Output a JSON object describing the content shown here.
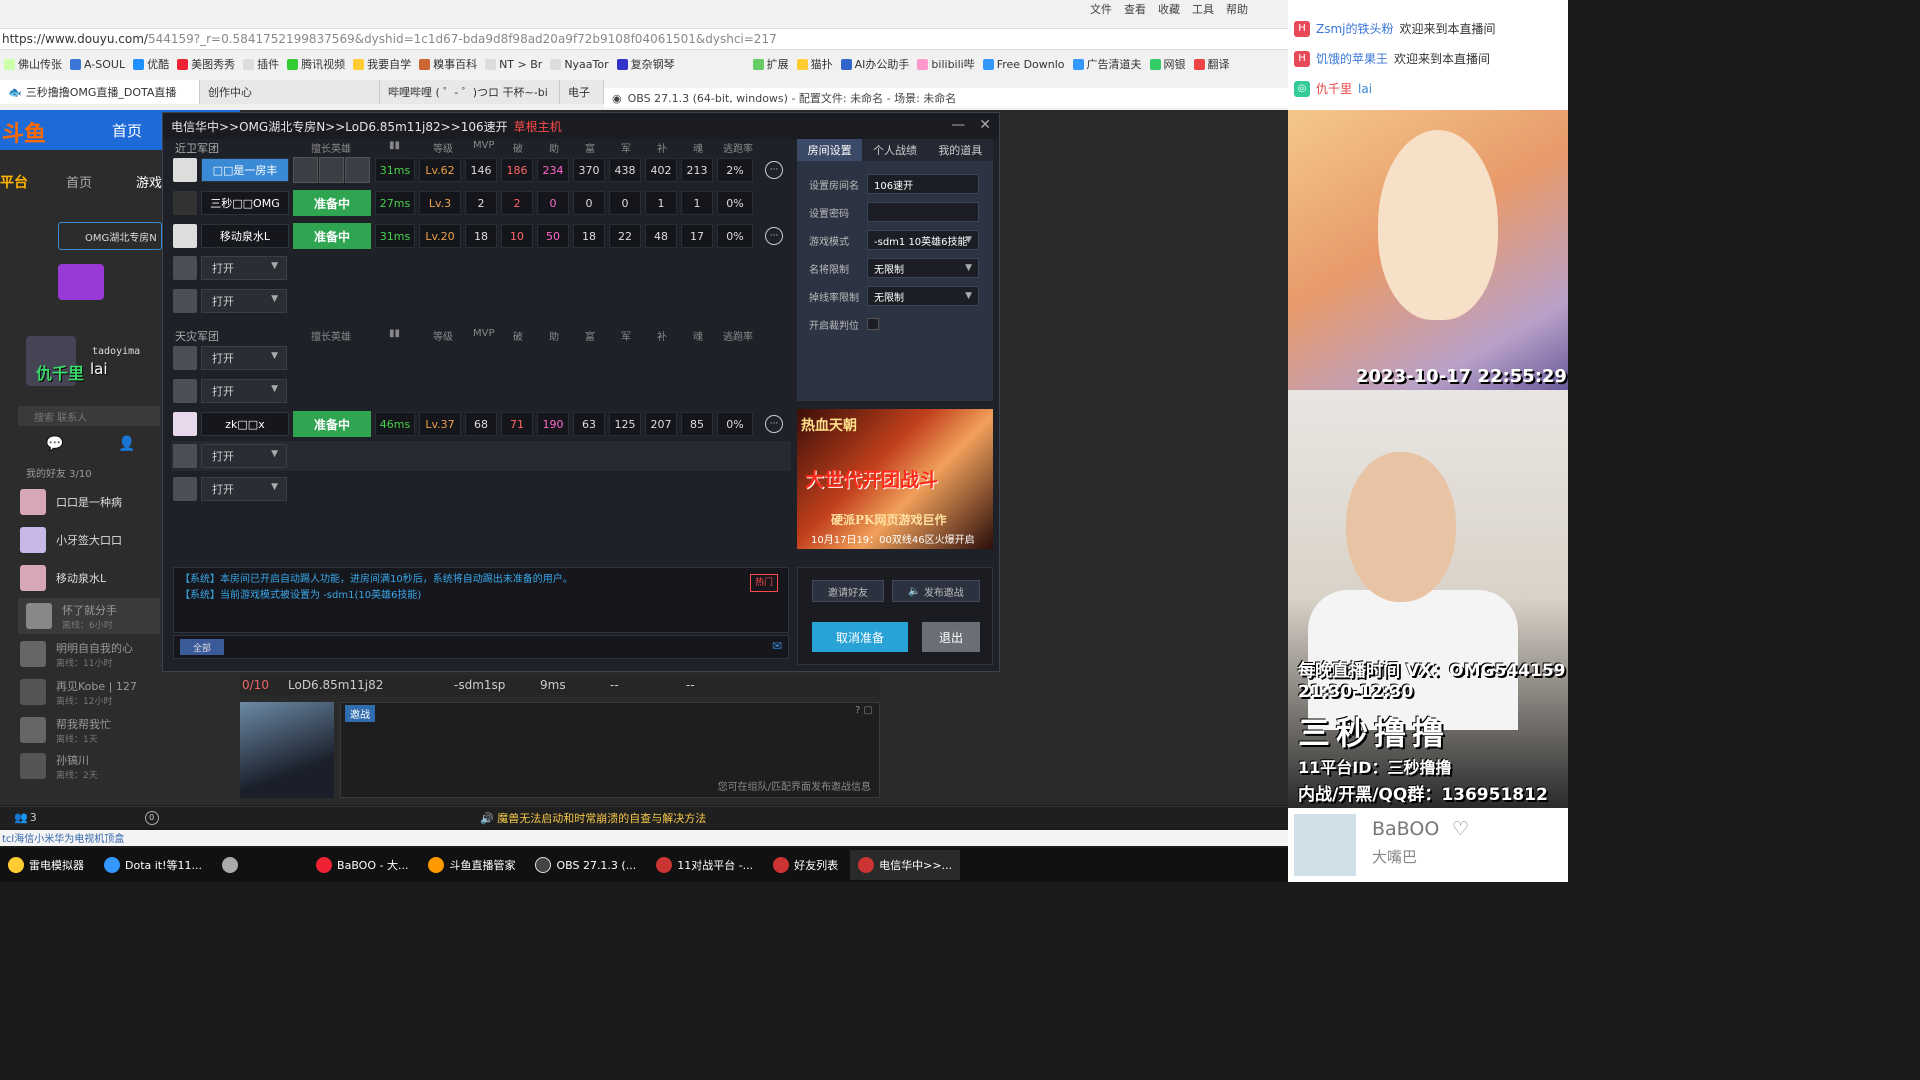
{
  "browser": {
    "menu": [
      "文件",
      "查看",
      "收藏",
      "工具",
      "帮助"
    ],
    "url_main": "https://www.douyu.com/",
    "url_rest": "544159?_r=0.5841752199837569&dyshid=1c1d67-bda9d8f98ad20a9f72b9108f04061501&dyshci=217",
    "bookmarks": [
      "佛山传张",
      "A-SOUL",
      "优酷",
      "美图秀秀",
      "插件",
      "腾讯视频",
      "我要自学",
      "糗事百科",
      "NT > Br",
      "NyaaTor",
      "复杂钢琴",
      "扩展",
      "猫扑",
      "AI办公助手",
      "bilibili哔",
      "Free Downlo",
      "广告清道夫",
      "网银",
      "翻译"
    ],
    "tabs": [
      {
        "label": "三秒撸撸OMG直播_DOTA直播",
        "active": true
      },
      {
        "label": "创作中心",
        "active": false
      },
      {
        "label": "哔哩哔哩 ( ゜- ゜)つロ 干杯~-bi",
        "active": false
      },
      {
        "label": "电子",
        "active": false
      }
    ],
    "obs_title": "OBS 27.1.3 (64-bit, windows) - 配置文件: 未命名 - 场景: 未命名"
  },
  "douyu": {
    "logo": "斗鱼",
    "home": "首页",
    "nav": [
      "平台",
      "首页",
      "游戏"
    ],
    "streamer_nick": "tadoyima",
    "overlay_name": "仇千里",
    "overlay_msg": "lai",
    "room_tag": "OMG湖北专房N",
    "search_placeholder": "搜索 联系人",
    "friends_header": "我的好友 3/10",
    "friends": [
      {
        "name": "口口是一种病",
        "status": ""
      },
      {
        "name": "小牙签大口口",
        "status": ""
      },
      {
        "name": "移动泉水L",
        "status": ""
      },
      {
        "name": "怀了就分手",
        "status": "离线：6小时"
      },
      {
        "name": "明明自自我的心",
        "status": "离线：11小时"
      },
      {
        "name": "再见Kobe | 127",
        "status": "离线：12小时"
      },
      {
        "name": "帮我帮我忙",
        "status": "离线：1天"
      },
      {
        "name": "孙镐川",
        "status": "离线：2天"
      }
    ]
  },
  "client": {
    "title": "电信华中>>OMG湖北专房N>>LoD6.85m11j82>>106速开",
    "host_tag": "草根主机",
    "sentinel_label": "近卫军团",
    "scourge_label": "天灾军团",
    "columns": [
      "擅长英雄",
      "等级",
      "MVP",
      "破",
      "助",
      "富",
      "军",
      "补",
      "魂",
      "逃跑率"
    ],
    "ready_label": "准备中",
    "open_label": "打开",
    "sentinel": [
      {
        "name": "□□是一房丰",
        "host": true,
        "heroes": true,
        "ping": "31ms",
        "lv": "Lv.62",
        "v1": "146",
        "v2": "186",
        "v3": "234",
        "v4": "370",
        "v5": "438",
        "v6": "402",
        "v7": "213",
        "v8": "2%"
      },
      {
        "name": "三秒□□OMG",
        "ready": true,
        "ping": "27ms",
        "lv": "Lv.3",
        "v1": "2",
        "v2": "2",
        "v3": "0",
        "v4": "0",
        "v5": "0",
        "v6": "1",
        "v7": "1",
        "v8": "0%"
      },
      {
        "name": "移动泉水L",
        "ready": true,
        "ping": "31ms",
        "lv": "Lv.20",
        "v1": "18",
        "v2": "10",
        "v3": "50",
        "v4": "18",
        "v5": "22",
        "v6": "48",
        "v7": "17",
        "v8": "0%"
      }
    ],
    "scourge_player": {
      "name": "zk□□x",
      "ping": "46ms",
      "lv": "Lv.37",
      "v1": "68",
      "v2": "71",
      "v3": "190",
      "v4": "63",
      "v5": "125",
      "v6": "207",
      "v7": "85",
      "v8": "0%"
    },
    "settings_tabs": [
      "房间设置",
      "个人战绩",
      "我的道具"
    ],
    "settings": [
      {
        "label": "设置房间名",
        "value": "106速开",
        "dropdown": false
      },
      {
        "label": "设置密码",
        "value": "",
        "dropdown": false
      },
      {
        "label": "游戏模式",
        "value": "-sdm1 10英雄6技能",
        "dropdown": true
      },
      {
        "label": "名将限制",
        "value": "无限制",
        "dropdown": true
      },
      {
        "label": "掉线率限制",
        "value": "无限制",
        "dropdown": true
      },
      {
        "label": "开启裁判位",
        "value": "",
        "checkbox": true
      }
    ],
    "ad": {
      "t1": "热血天朝",
      "t2": "大世代开团战斗",
      "t3": "硬派PK网页游戏巨作",
      "t4": "10月17日19：00双线46区火爆开启"
    },
    "sys_msgs": [
      "【系统】本房间已开启自动踢人功能，进房间满10秒后，系统将自动踢出未准备的用户。",
      "【系统】当前游戏模式被设置为 -sdm1(10英雄6技能)"
    ],
    "hot": "热门",
    "all_btn": "全部",
    "invite_btn": "邀请好友",
    "publish_btn": "发布邀战",
    "cancel_btn": "取消准备",
    "exit_btn": "退出"
  },
  "lower": {
    "room_row": [
      "0/10",
      "LoD6.85m11j82",
      "-sdm1sp",
      "9ms",
      "--",
      "--"
    ],
    "invite_tag": "邀战",
    "invite_note": "您可在组队/匹配界面发布邀战信息",
    "warning": "魔兽无法启动和时常崩溃的自查与解决方法",
    "net_text": "tcl海信小米华为电视机顶盒",
    "status_count": "3",
    "vip_badge": "0"
  },
  "taskbar": [
    "雷电模拟器",
    "Dota it!等11...",
    "BaBOO - 大...",
    "斗鱼直播管家",
    "OBS 27.1.3 (...",
    "11对战平台 -...",
    "好友列表",
    "电信华中>>..."
  ],
  "right_chat": [
    {
      "nick": "Zsmj的铁头粉",
      "msg": "欢迎来到本直播间"
    },
    {
      "nick": "饥饿的苹果王",
      "msg": "欢迎来到本直播间"
    },
    {
      "nick": "仇千里",
      "msg": "lai"
    }
  ],
  "overlay": {
    "date": "2023-10-17 22:55:29",
    "line1": "每晚直播时间 VX：OMG544159",
    "line2": "21:30-12:30",
    "line3": "三秒撸撸",
    "line4": "11平台ID：三秒撸撸",
    "line5": "内战/开黑/QQ群：136951812",
    "br_name": "BaBOO",
    "br_sub": "大嘴巴"
  },
  "colors": {
    "host_blue": "#3a8ad6",
    "ready_green": "#2fa552",
    "cancel_blue": "#29a3d6",
    "sys_text": "#3aa6e8"
  }
}
